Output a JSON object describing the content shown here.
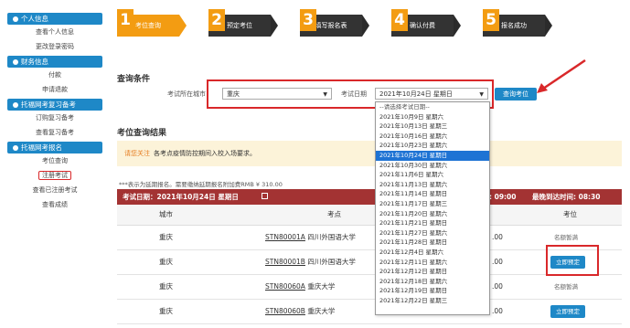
{
  "sidebar": {
    "sections": [
      {
        "title": "个人信息",
        "items": [
          "查看个人信息",
          "更改登录密码"
        ]
      },
      {
        "title": "财务信息",
        "items": [
          "付款",
          "申请退款"
        ]
      },
      {
        "title": "托福网考复习备考",
        "items": [
          "订购复习备考",
          "查看复习备考"
        ]
      },
      {
        "title": "托福网考报名",
        "items": [
          "考位查询",
          "注册考试",
          "查看已注册考试",
          "查看成绩"
        ]
      }
    ]
  },
  "steps": [
    {
      "num": "1",
      "label": "考位查询"
    },
    {
      "num": "2",
      "label": "预定考位"
    },
    {
      "num": "3",
      "label": "填写报名表"
    },
    {
      "num": "4",
      "label": "确认付费"
    },
    {
      "num": "5",
      "label": "报名成功"
    }
  ],
  "query": {
    "title": "查询条件",
    "city_label": "考试所在城市",
    "city_value": "重庆",
    "date_label": "考试日期",
    "date_value": "2021年10月24日 星期日",
    "search_button": "查询考位"
  },
  "date_options": [
    "--请选择考试日期--",
    "2021年10月9日 星期六",
    "2021年10月13日 星期三",
    "2021年10月16日 星期六",
    "2021年10月23日 星期六",
    "2021年10月24日 星期日",
    "2021年10月30日 星期六",
    "2021年11月6日 星期六",
    "2021年11月13日 星期六",
    "2021年11月14日 星期日",
    "2021年11月17日 星期三",
    "2021年11月20日 星期六",
    "2021年11月21日 星期日",
    "2021年11月27日 星期六",
    "2021年11月28日 星期日",
    "2021年12月4日 星期六",
    "2021年12月11日 星期六",
    "2021年12月12日 星期日",
    "2021年12月18日 星期六",
    "2021年12月19日 星期日",
    "2021年12月22日 星期三"
  ],
  "results": {
    "title": "考位查询结果",
    "alert_prefix": "请您关注",
    "alert_text": "各考点疫情防控期间入校入场要求。",
    "note": "***表示为延期报名。需要缴纳延期报名附加费RMB ¥ 310.00",
    "bar_date": "考试日期：2021年10月24日 星期日",
    "bar_time1": ": 09:00",
    "bar_time2": "最晚到达时间: 08:30",
    "headers": {
      "city": "城市",
      "center": "考点",
      "seat": "考位"
    },
    "rows": [
      {
        "city": "重庆",
        "code": "STN80001A",
        "name": "四川外国语大学",
        "fee": ".00",
        "status": "名额暂满"
      },
      {
        "city": "重庆",
        "code": "STN80001B",
        "name": "四川外国语大学",
        "fee": ".00",
        "status": "立即预定"
      },
      {
        "city": "重庆",
        "code": "STN80060A",
        "name": "重庆大学",
        "fee": ".00",
        "status": "名额暂满"
      },
      {
        "city": "重庆",
        "code": "STN80060B",
        "name": "重庆大学",
        "fee": ".00",
        "status": "立即预定"
      }
    ]
  },
  "colors": {
    "brand": "#1e88c7",
    "accent": "#f39c12",
    "bar": "#a33333",
    "highlight": "#d9282a"
  }
}
